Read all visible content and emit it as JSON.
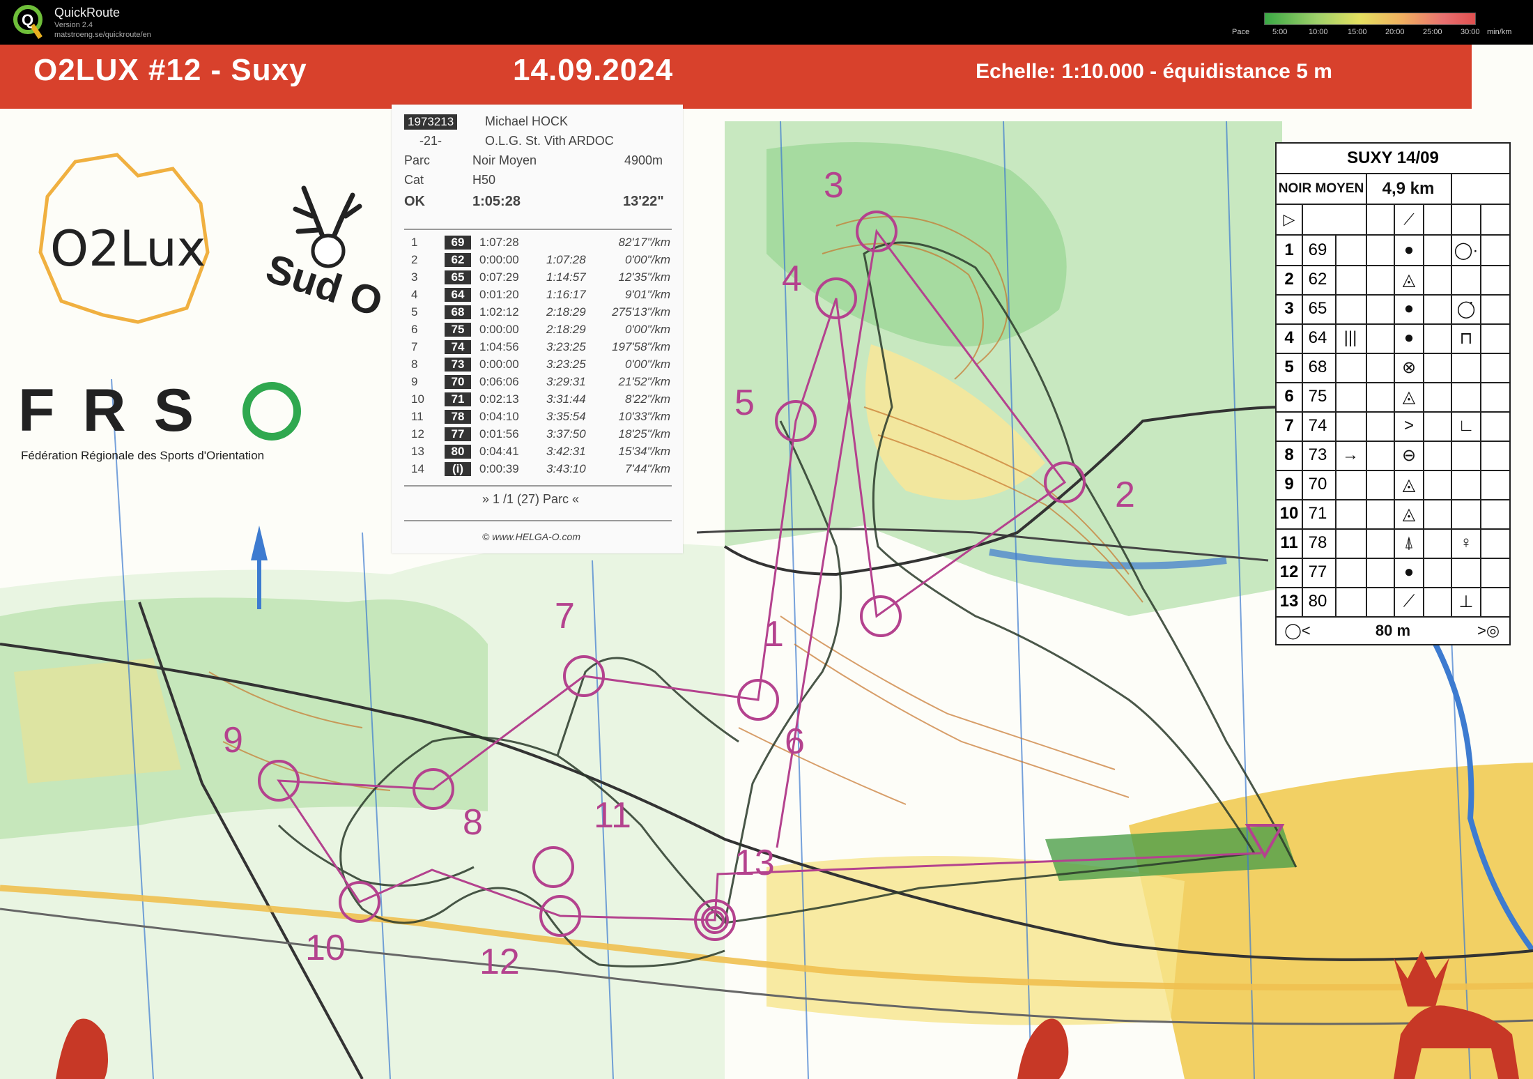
{
  "app": {
    "title": "QuickRoute",
    "version": "Version 2.4",
    "url": "matstroeng.se/quickroute/en",
    "icon": "quickroute-q-icon"
  },
  "pace_legend": {
    "label": "Pace",
    "ticks": [
      "5:00",
      "10:00",
      "15:00",
      "20:00",
      "25:00",
      "30:00"
    ],
    "unit": "min/km",
    "colors": [
      "#3aa845",
      "#9fd06a",
      "#e4e060",
      "#f0b060",
      "#e87070",
      "#e05050"
    ]
  },
  "map_header": {
    "title": "O2LUX #12 - Suxy",
    "date": "14.09.2024",
    "scale": "Echelle: 1:10.000 - équidistance 5 m",
    "band_color": "#d8412c"
  },
  "logos": {
    "o2lux": "O2Lux",
    "frso_letters": "FRS",
    "frso_full": "Fédération Régionale des Sports d'Orientation",
    "sud_o": "Sud O"
  },
  "splits": {
    "id": "1973213",
    "name": "Michael HOCK",
    "club_num": "-21-",
    "club": "O.L.G. St. Vith ARDOC",
    "parc_label": "Parc",
    "parc": "Noir Moyen",
    "distance": "4900m",
    "cat_label": "Cat",
    "cat": "H50",
    "status": "OK",
    "total": "1:05:28",
    "pace": "13'22\"",
    "rows": [
      {
        "n": "1",
        "code": "69",
        "split": "1:07:28",
        "time": "",
        "pace": "82'17\"/km"
      },
      {
        "n": "2",
        "code": "62",
        "split": "0:00:00",
        "time": "1:07:28",
        "pace": "0'00\"/km"
      },
      {
        "n": "3",
        "code": "65",
        "split": "0:07:29",
        "time": "1:14:57",
        "pace": "12'35\"/km"
      },
      {
        "n": "4",
        "code": "64",
        "split": "0:01:20",
        "time": "1:16:17",
        "pace": "9'01\"/km"
      },
      {
        "n": "5",
        "code": "68",
        "split": "1:02:12",
        "time": "2:18:29",
        "pace": "275'13\"/km"
      },
      {
        "n": "6",
        "code": "75",
        "split": "0:00:00",
        "time": "2:18:29",
        "pace": "0'00\"/km"
      },
      {
        "n": "7",
        "code": "74",
        "split": "1:04:56",
        "time": "3:23:25",
        "pace": "197'58\"/km"
      },
      {
        "n": "8",
        "code": "73",
        "split": "0:00:00",
        "time": "3:23:25",
        "pace": "0'00\"/km"
      },
      {
        "n": "9",
        "code": "70",
        "split": "0:06:06",
        "time": "3:29:31",
        "pace": "21'52\"/km"
      },
      {
        "n": "10",
        "code": "71",
        "split": "0:02:13",
        "time": "3:31:44",
        "pace": "8'22\"/km"
      },
      {
        "n": "11",
        "code": "78",
        "split": "0:04:10",
        "time": "3:35:54",
        "pace": "10'33\"/km"
      },
      {
        "n": "12",
        "code": "77",
        "split": "0:01:56",
        "time": "3:37:50",
        "pace": "18'25\"/km"
      },
      {
        "n": "13",
        "code": "80",
        "split": "0:04:41",
        "time": "3:42:31",
        "pace": "15'34\"/km"
      },
      {
        "n": "14",
        "code": "(i)",
        "split": "0:00:39",
        "time": "3:43:10",
        "pace": "7'44\"/km"
      }
    ],
    "rank": "» 1 /1 (27) Parc «",
    "footer": "© www.HELGA-O.com"
  },
  "description_sheet": {
    "title": "SUXY 14/09",
    "course": "NOIR MOYEN",
    "length": "4,9 km",
    "finish_distance": "80 m",
    "controls": [
      {
        "n": "1",
        "code": "69",
        "feature": "●",
        "position": "◯·",
        "extra": ""
      },
      {
        "n": "2",
        "code": "62",
        "feature": "◬",
        "position": "",
        "extra": ""
      },
      {
        "n": "3",
        "code": "65",
        "feature": "●",
        "position": "◯̇",
        "extra": ""
      },
      {
        "n": "4",
        "code": "64",
        "feature": "●",
        "position": "⊓",
        "extra": "|||"
      },
      {
        "n": "5",
        "code": "68",
        "feature": "⊗",
        "position": "",
        "extra": ""
      },
      {
        "n": "6",
        "code": "75",
        "feature": "◬",
        "position": "",
        "extra": ""
      },
      {
        "n": "7",
        "code": "74",
        "feature": ">",
        "position": "∟",
        "extra": ""
      },
      {
        "n": "8",
        "code": "73",
        "feature": "⊖",
        "position": "",
        "extra": "→"
      },
      {
        "n": "9",
        "code": "70",
        "feature": "◬",
        "position": "",
        "extra": ""
      },
      {
        "n": "10",
        "code": "71",
        "feature": "◬",
        "position": "",
        "extra": ""
      },
      {
        "n": "11",
        "code": "78",
        "feature": "⍋",
        "position": "♀",
        "extra": ""
      },
      {
        "n": "12",
        "code": "77",
        "feature": "●",
        "position": "",
        "extra": ""
      },
      {
        "n": "13",
        "code": "80",
        "feature": "⟋",
        "position": "⊥",
        "extra": ""
      }
    ]
  },
  "course_controls": [
    "1",
    "2",
    "3",
    "4",
    "5",
    "6",
    "7",
    "8",
    "9",
    "10",
    "11",
    "12",
    "13"
  ],
  "colors": {
    "course_magenta": "#b4428e",
    "route_dark": "#2a3a2a",
    "forest_green": "#2fa84f",
    "open_yellow": "#f2d04a",
    "contour_brown": "#c8772e",
    "water_blue": "#3d7bd0"
  }
}
